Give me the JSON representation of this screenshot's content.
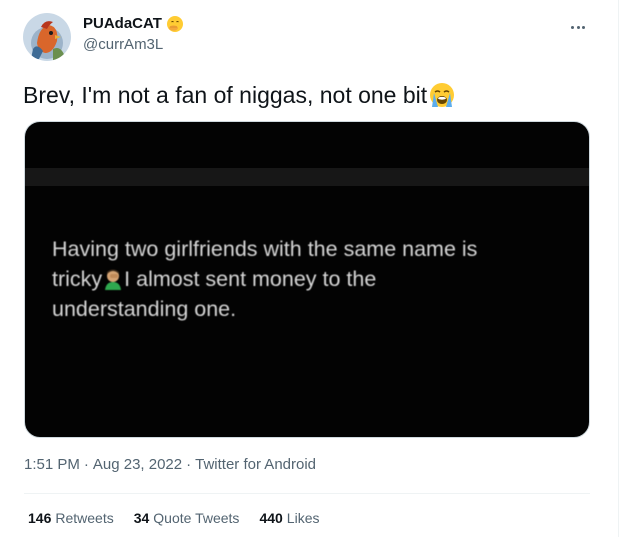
{
  "author": {
    "display_name": "PUAdaCAT",
    "handle": "@currAm3L",
    "name_emoji": "face-with-hand-over-mouth-emoji"
  },
  "tweet": {
    "text": "Brev, I'm not a fan of niggas, not one bit",
    "text_emoji": "loudly-crying-face-emoji"
  },
  "media": {
    "line1": "Having two girlfriends with the same name is",
    "line2_before": "tricky",
    "line2_after": "I almost sent money to the",
    "line3": "understanding one.",
    "inline_emoji": "man-facepalming-emoji"
  },
  "meta": {
    "time": "1:51 PM",
    "separator": "·",
    "date": "Aug 23, 2022",
    "separator2": "·",
    "source": "Twitter for Android"
  },
  "stats": {
    "retweets_count": "146",
    "retweets_label": "Retweets",
    "quotes_count": "34",
    "quotes_label": "Quote Tweets",
    "likes_count": "440",
    "likes_label": "Likes"
  },
  "colors": {
    "text_primary": "#0f1419",
    "text_secondary": "#536471",
    "media_bg": "#030303",
    "divider": "#eff3f4"
  }
}
